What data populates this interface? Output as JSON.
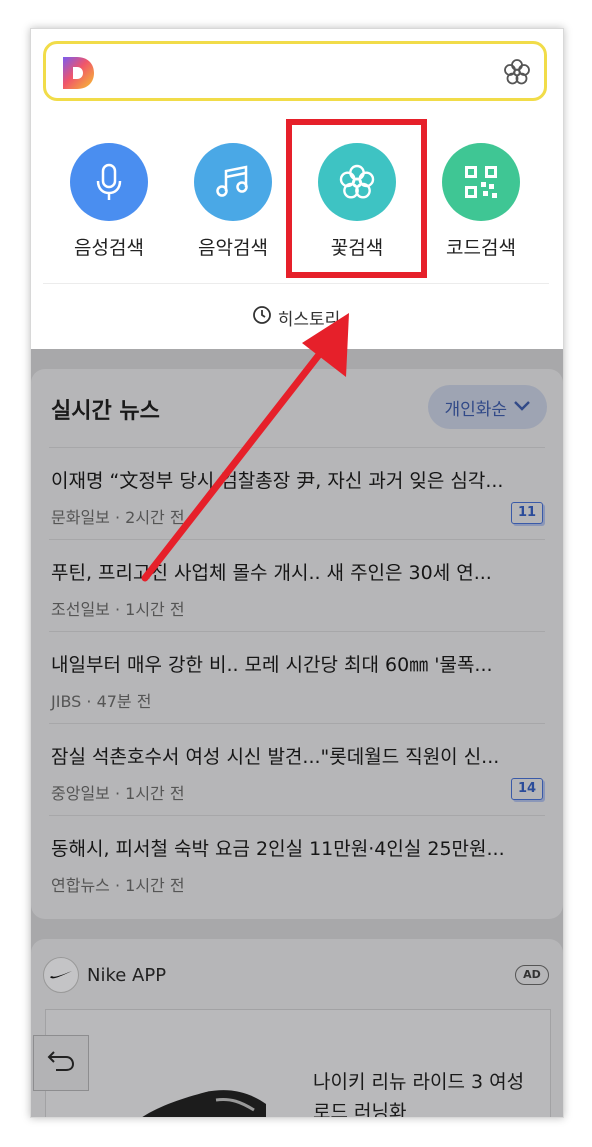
{
  "search": {
    "placeholder": ""
  },
  "tools": [
    {
      "label": "음성검색",
      "icon": "microphone-icon",
      "color": "#4a8ef0"
    },
    {
      "label": "음악검색",
      "icon": "music-note-icon",
      "color": "#4aa8e6"
    },
    {
      "label": "꽃검색",
      "icon": "flower-icon",
      "color": "#3ec3c3"
    },
    {
      "label": "코드검색",
      "icon": "qr-code-icon",
      "color": "#3fc694"
    }
  ],
  "history": {
    "label": "히스토리"
  },
  "news": {
    "title": "실시간 뉴스",
    "filter_label": "개인화순",
    "items": [
      {
        "headline": "이재명 “文정부 당시 검찰총장 尹, 자신 과거 잊은 심각...",
        "source": "문화일보",
        "time": "2시간 전",
        "count": "11"
      },
      {
        "headline": "푸틴, 프리고진 사업체 몰수 개시.. 새 주인은 30세 연...",
        "source": "조선일보",
        "time": "1시간 전",
        "count": ""
      },
      {
        "headline": "내일부터 매우 강한 비.. 모레 시간당 최대 60㎜ '물폭...",
        "source": "JIBS",
        "time": "47분 전",
        "count": ""
      },
      {
        "headline": "잠실 석촌호수서 여성 시신 발견...\"롯데월드 직원이 신...",
        "source": "중앙일보",
        "time": "1시간 전",
        "count": "14"
      },
      {
        "headline": "동해시, 피서철 숙박 요금 2인실 11만원·4인실 25만원...",
        "source": "연합뉴스",
        "time": "1시간 전",
        "count": ""
      }
    ]
  },
  "ad": {
    "advertiser": "Nike APP",
    "badge": "AD",
    "text": "나이키 리뉴 라이드 3 여성 로드 러닝화"
  },
  "colors": {
    "highlight": "#e6202a",
    "search_border": "#f1dc49"
  }
}
